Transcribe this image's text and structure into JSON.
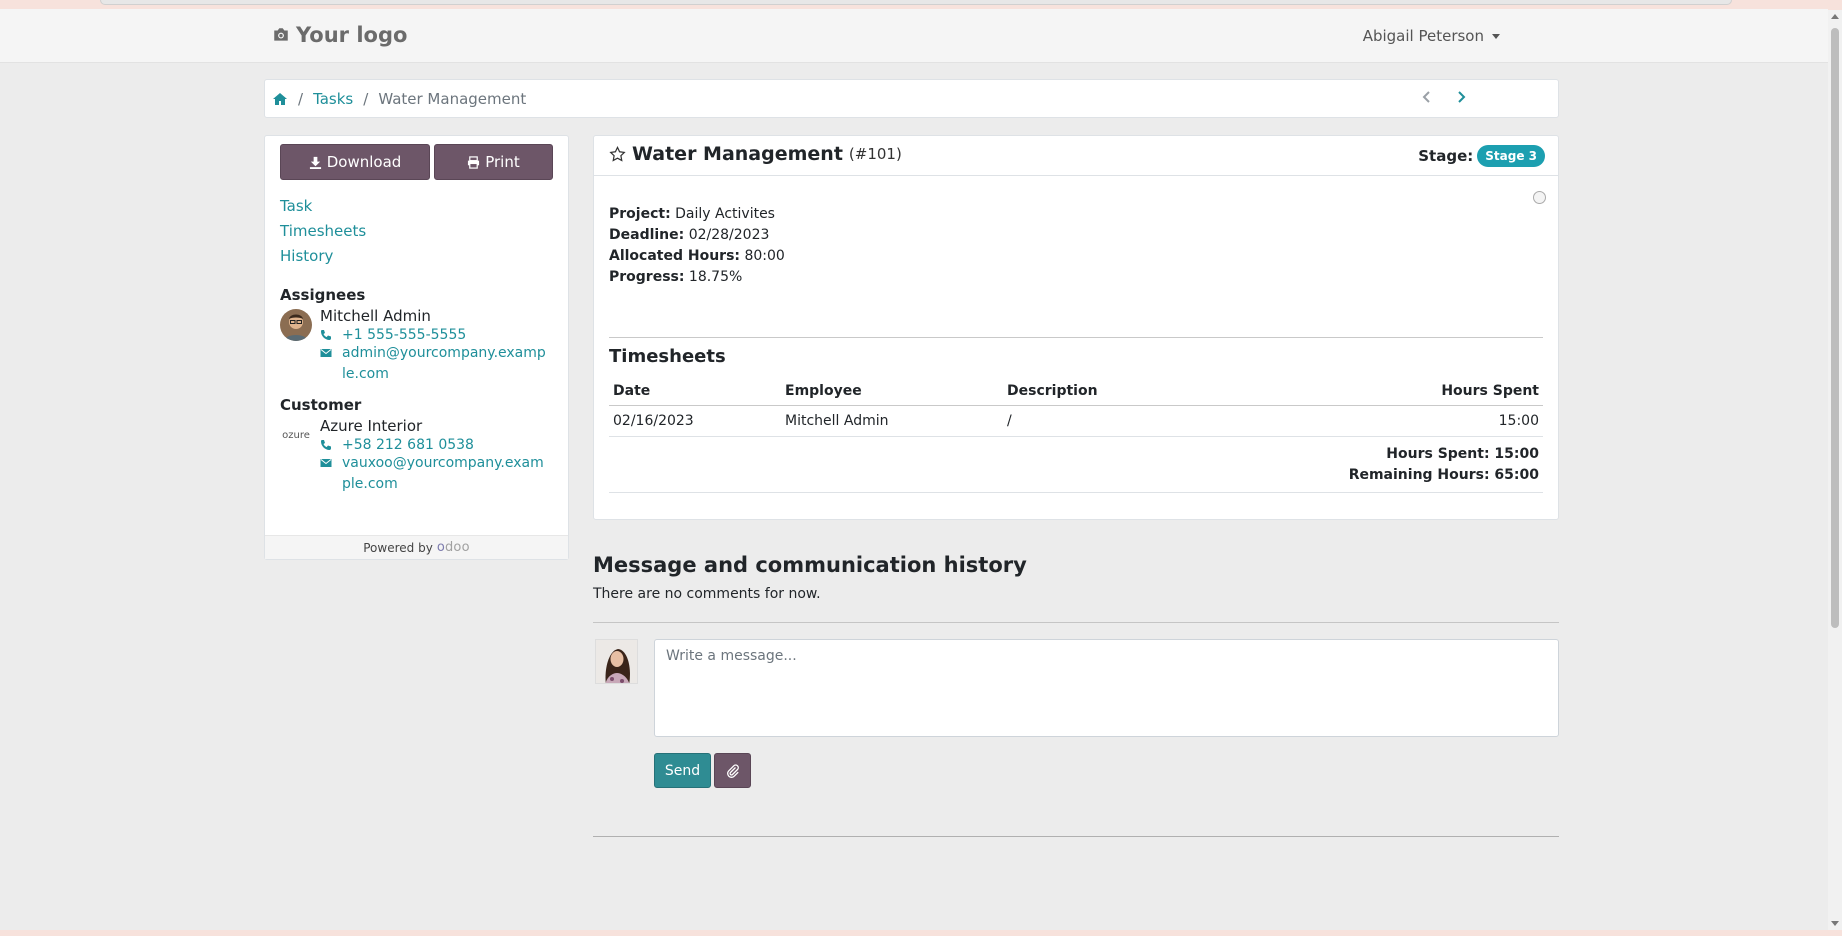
{
  "navbar": {
    "logo_text": "Your logo",
    "user_name": "Abigail Peterson"
  },
  "breadcrumb": {
    "items": [
      "Tasks",
      "Water Management"
    ]
  },
  "sidebar": {
    "download_label": "Download",
    "print_label": "Print",
    "links": [
      "Task",
      "Timesheets",
      "History"
    ],
    "assignees_title": "Assignees",
    "assignee": {
      "name": "Mitchell Admin",
      "phone": "+1 555-555-5555",
      "email": "admin@yourcompany.example.com"
    },
    "customer_title": "Customer",
    "customer": {
      "name": "Azure Interior",
      "logo_text": "ozure",
      "phone": "+58 212 681 0538",
      "email": "vauxoo@yourcompany.example.com"
    },
    "powered_by": "Powered by",
    "odoo_brand": [
      "o",
      "doo"
    ]
  },
  "task": {
    "title": "Water Management",
    "ref": "(#101)",
    "stage_label": "Stage:",
    "stage_value": "Stage 3",
    "details": [
      {
        "label": "Project:",
        "value": "Daily Activites"
      },
      {
        "label": "Deadline:",
        "value": "02/28/2023"
      },
      {
        "label": "Allocated Hours:",
        "value": "80:00"
      },
      {
        "label": "Progress:",
        "value": "18.75%"
      }
    ]
  },
  "timesheets": {
    "title": "Timesheets",
    "headers": {
      "date": "Date",
      "employee": "Employee",
      "description": "Description",
      "hours": "Hours Spent"
    },
    "rows": [
      {
        "date": "02/16/2023",
        "employee": "Mitchell Admin",
        "description": "/",
        "hours": "15:00"
      }
    ],
    "hours_spent": "Hours Spent: 15:00",
    "remaining": "Remaining Hours: 65:00"
  },
  "messages": {
    "title": "Message and communication history",
    "empty_text": "There are no comments for now.",
    "placeholder": "Write a message...",
    "send_label": "Send"
  },
  "colors": {
    "accent": "#1f8f9a",
    "button_dark": "#6d5668",
    "stage_badge": "#1c9fb0",
    "send_button": "#2f8c93"
  }
}
